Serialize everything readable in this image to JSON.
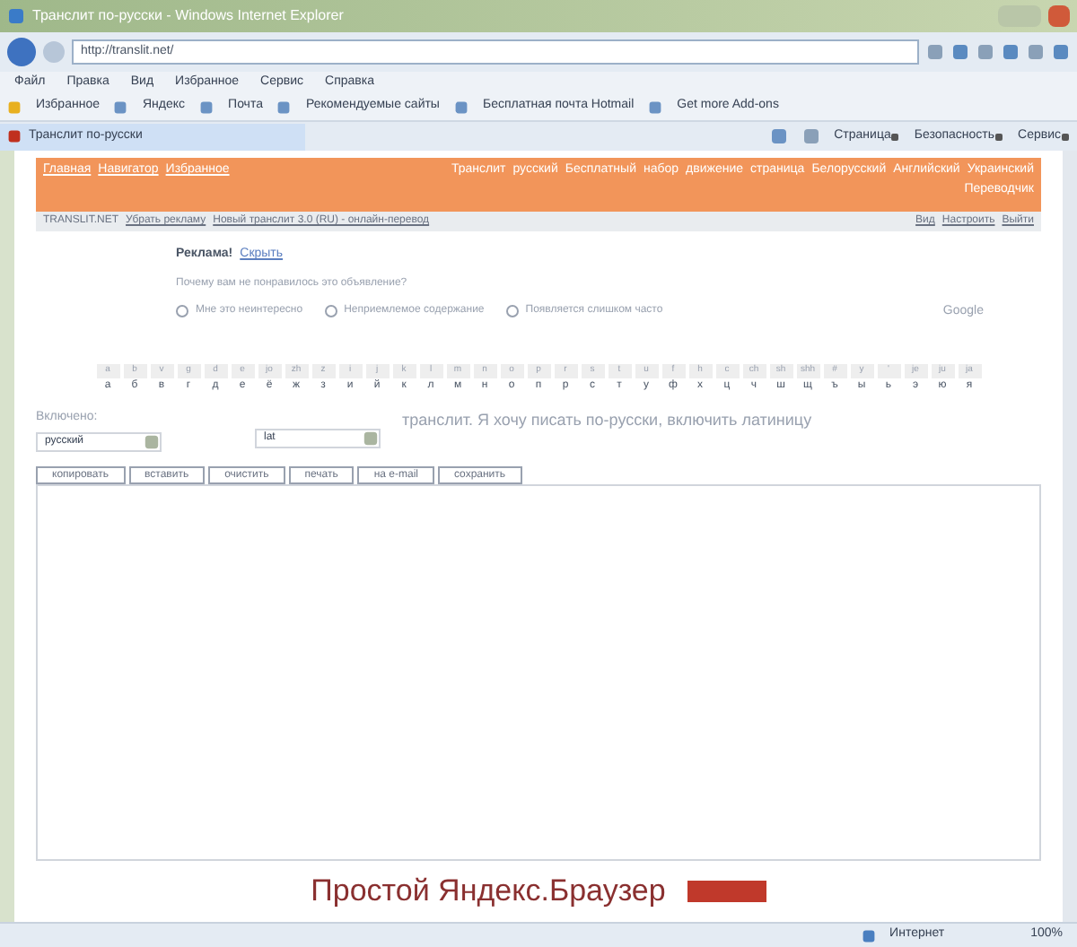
{
  "window": {
    "title": "Транслит по-русски - Windows Internet Explorer"
  },
  "address": {
    "url": "http://translit.net/"
  },
  "menu": [
    "Файл",
    "Правка",
    "Вид",
    "Избранное",
    "Сервис",
    "Справка"
  ],
  "favorites": [
    "Избранное",
    "Яндекс",
    "Почта",
    "Рекомендуемые сайты",
    "Бесплатная почта Hotmail",
    "Get more Add-ons"
  ],
  "tab": {
    "title": "Транслит по-русски"
  },
  "commands": [
    "Страница",
    "Безопасность",
    "Сервис"
  ],
  "site_header": {
    "left": [
      "Главная",
      "Навигатор",
      "Избранное"
    ],
    "right": [
      "Транслит",
      "русский",
      "Бесплатный",
      "набор",
      "движение",
      "страница",
      "Белорусский",
      "Английский",
      "Украинский",
      "Переводчик"
    ]
  },
  "breadcrumb": {
    "site": "TRANSLIT.NET",
    "links": [
      "Убрать рекламу",
      "Новый транслит 3.0 (RU) - онлайн-перевод"
    ],
    "right": [
      "Вид",
      "Настроить",
      "Выйти"
    ]
  },
  "ad_feedback": {
    "title": "Реклама!",
    "link": "Скрыть",
    "question": "Почему вам не понравилось это объявление?",
    "options": [
      {
        "label": "Мне это неинтересно",
        "selected": false
      },
      {
        "label": "Неприемлемое содержание",
        "selected": false
      },
      {
        "label": "Появляется слишком часто",
        "selected": false
      }
    ],
    "brand": "Google"
  },
  "keyboard": [
    {
      "lat": "a",
      "cyr": "а"
    },
    {
      "lat": "b",
      "cyr": "б"
    },
    {
      "lat": "v",
      "cyr": "в"
    },
    {
      "lat": "g",
      "cyr": "г"
    },
    {
      "lat": "d",
      "cyr": "д"
    },
    {
      "lat": "e",
      "cyr": "е"
    },
    {
      "lat": "jo",
      "cyr": "ё"
    },
    {
      "lat": "zh",
      "cyr": "ж"
    },
    {
      "lat": "z",
      "cyr": "з"
    },
    {
      "lat": "i",
      "cyr": "и"
    },
    {
      "lat": "j",
      "cyr": "й"
    },
    {
      "lat": "k",
      "cyr": "к"
    },
    {
      "lat": "l",
      "cyr": "л"
    },
    {
      "lat": "m",
      "cyr": "м"
    },
    {
      "lat": "n",
      "cyr": "н"
    },
    {
      "lat": "o",
      "cyr": "о"
    },
    {
      "lat": "p",
      "cyr": "п"
    },
    {
      "lat": "r",
      "cyr": "р"
    },
    {
      "lat": "s",
      "cyr": "с"
    },
    {
      "lat": "t",
      "cyr": "т"
    },
    {
      "lat": "u",
      "cyr": "у"
    },
    {
      "lat": "f",
      "cyr": "ф"
    },
    {
      "lat": "h",
      "cyr": "х"
    },
    {
      "lat": "c",
      "cyr": "ц"
    },
    {
      "lat": "ch",
      "cyr": "ч"
    },
    {
      "lat": "sh",
      "cyr": "ш"
    },
    {
      "lat": "shh",
      "cyr": "щ"
    },
    {
      "lat": "#",
      "cyr": "ъ"
    },
    {
      "lat": "y",
      "cyr": "ы"
    },
    {
      "lat": "'",
      "cyr": "ь"
    },
    {
      "lat": "je",
      "cyr": "э"
    },
    {
      "lat": "ju",
      "cyr": "ю"
    },
    {
      "lat": "ja",
      "cyr": "я"
    }
  ],
  "language": {
    "label": "Включено:",
    "value": "русский",
    "second_value": "lat",
    "hint": "транслит. Я хочу писать по-русски, включить латиницу"
  },
  "toolbar": [
    "копировать",
    "вставить",
    "очистить",
    "печать",
    "на e-mail",
    "сохранить"
  ],
  "banner": {
    "text": "Простой Яндекс.Браузер"
  },
  "status_bar": {
    "zone": "Интернет",
    "zoom": "100%"
  }
}
